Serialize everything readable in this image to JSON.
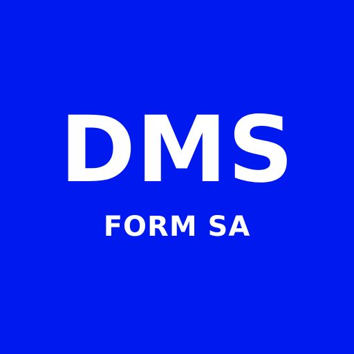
{
  "logo": {
    "title": "DMS",
    "subtitle": "FORM SA",
    "background_color": "#0019EE",
    "text_color": "#FFFFFF"
  }
}
